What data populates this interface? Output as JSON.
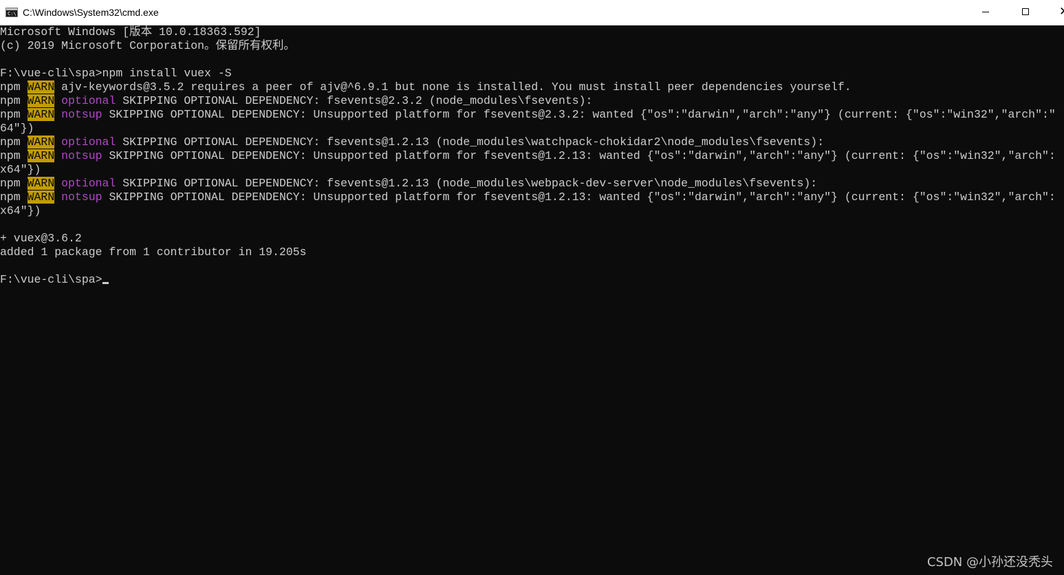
{
  "window": {
    "title": "C:\\Windows\\System32\\cmd.exe",
    "icon_label": "C:\\",
    "minimize_icon": "minimize-icon",
    "maximize_icon": "maximize-icon",
    "close_icon": "close-icon",
    "close_glyph": "✕"
  },
  "colors": {
    "background": "#0c0c0c",
    "text": "#cccccc",
    "warn_bg": "#c19c00",
    "magenta": "#b148c6"
  },
  "console": {
    "lines": [
      [
        {
          "t": "Microsoft Windows [版本 10.0.18363.592]"
        }
      ],
      [
        {
          "t": "(c) 2019 Microsoft Corporation。保留所有权利。"
        }
      ],
      [
        {
          "t": ""
        }
      ],
      [
        {
          "t": "F:\\vue-cli\\spa>npm install vuex -S"
        }
      ],
      [
        {
          "t": "npm "
        },
        {
          "t": "WARN",
          "s": "warn"
        },
        {
          "t": " ajv-keywords@3.5.2 requires a peer of ajv@^6.9.1 but none is installed. You must install peer dependencies yourself."
        }
      ],
      [
        {
          "t": "npm "
        },
        {
          "t": "WARN",
          "s": "warn"
        },
        {
          "t": " "
        },
        {
          "t": "optional",
          "s": "magenta"
        },
        {
          "t": " SKIPPING OPTIONAL DEPENDENCY: fsevents@2.3.2 (node_modules\\fsevents):"
        }
      ],
      [
        {
          "t": "npm "
        },
        {
          "t": "WARN",
          "s": "warn"
        },
        {
          "t": " "
        },
        {
          "t": "notsup",
          "s": "magenta"
        },
        {
          "t": " SKIPPING OPTIONAL DEPENDENCY: Unsupported platform for fsevents@2.3.2: wanted {\"os\":\"darwin\",\"arch\":\"any\"} (current: {\"os\":\"win32\",\"arch\":\""
        }
      ],
      [
        {
          "t": "64\"})"
        }
      ],
      [
        {
          "t": "npm "
        },
        {
          "t": "WARN",
          "s": "warn"
        },
        {
          "t": " "
        },
        {
          "t": "optional",
          "s": "magenta"
        },
        {
          "t": " SKIPPING OPTIONAL DEPENDENCY: fsevents@1.2.13 (node_modules\\watchpack-chokidar2\\node_modules\\fsevents):"
        }
      ],
      [
        {
          "t": "npm "
        },
        {
          "t": "WARN",
          "s": "warn"
        },
        {
          "t": " "
        },
        {
          "t": "notsup",
          "s": "magenta"
        },
        {
          "t": " SKIPPING OPTIONAL DEPENDENCY: Unsupported platform for fsevents@1.2.13: wanted {\"os\":\"darwin\",\"arch\":\"any\"} (current: {\"os\":\"win32\",\"arch\":"
        }
      ],
      [
        {
          "t": "x64\"})"
        }
      ],
      [
        {
          "t": "npm "
        },
        {
          "t": "WARN",
          "s": "warn"
        },
        {
          "t": " "
        },
        {
          "t": "optional",
          "s": "magenta"
        },
        {
          "t": " SKIPPING OPTIONAL DEPENDENCY: fsevents@1.2.13 (node_modules\\webpack-dev-server\\node_modules\\fsevents):"
        }
      ],
      [
        {
          "t": "npm "
        },
        {
          "t": "WARN",
          "s": "warn"
        },
        {
          "t": " "
        },
        {
          "t": "notsup",
          "s": "magenta"
        },
        {
          "t": " SKIPPING OPTIONAL DEPENDENCY: Unsupported platform for fsevents@1.2.13: wanted {\"os\":\"darwin\",\"arch\":\"any\"} (current: {\"os\":\"win32\",\"arch\":"
        }
      ],
      [
        {
          "t": "x64\"})"
        }
      ],
      [
        {
          "t": ""
        }
      ],
      [
        {
          "t": "+ vuex@3.6.2"
        }
      ],
      [
        {
          "t": "added 1 package from 1 contributor in 19.205s"
        }
      ],
      [
        {
          "t": ""
        }
      ],
      [
        {
          "t": "F:\\vue-cli\\spa>"
        },
        {
          "s": "cursor"
        }
      ]
    ]
  },
  "watermark": "CSDN @小孙还没秃头"
}
